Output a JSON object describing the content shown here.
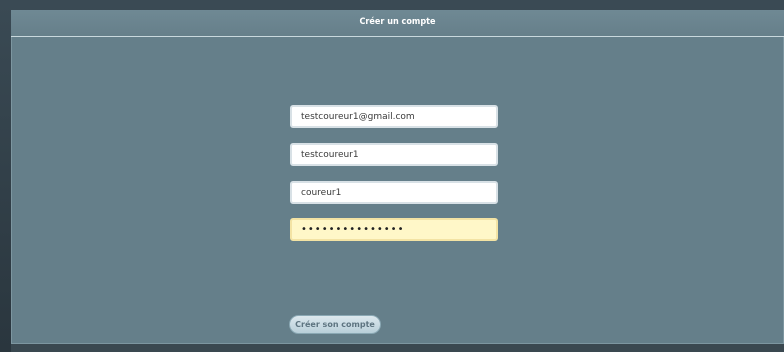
{
  "form": {
    "title": "Créer un compte",
    "email_value": "testcoureur1@gmail.com",
    "username_value": "testcoureur1",
    "name_value": "coureur1",
    "password_value": "•••••••••••••••",
    "submit_label": "Créer son compte"
  },
  "colors": {
    "panel": "#657f8a",
    "password_highlight": "#fff7c8"
  }
}
